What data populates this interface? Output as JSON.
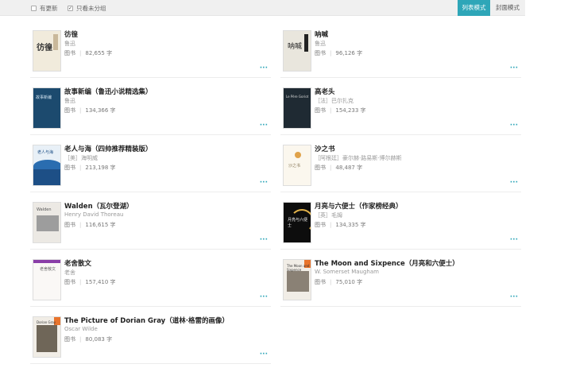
{
  "toolbar": {
    "filter_updated": "有更新",
    "filter_ungrouped": "只看未分组",
    "filter_updated_checked": false,
    "filter_ungrouped_checked": true,
    "mode_list": "列表模式",
    "mode_cover": "封面模式"
  },
  "books": [
    {
      "title": "彷徨",
      "author": "鲁迅",
      "type": "图书",
      "words": "82,655 字",
      "cover_text": "彷徨",
      "cover_icon": "cover-fanghuang"
    },
    {
      "title": "呐喊",
      "author": "鲁迅",
      "type": "图书",
      "words": "96,126 字",
      "cover_text": "呐喊",
      "cover_icon": "cover-nahan"
    },
    {
      "title": "故事新编（鲁迅小说精选集）",
      "author": "鲁迅",
      "type": "图书",
      "words": "134,366 字",
      "cover_text": "故事新编",
      "cover_icon": "cover-gushi"
    },
    {
      "title": "高老头",
      "author": "［法］巴尔扎克",
      "type": "图书",
      "words": "154,233 字",
      "cover_text": "Le Père Goriot",
      "cover_icon": "cover-gaolao"
    },
    {
      "title": "老人与海（四帅推荐精装版）",
      "author": "［美］海明威",
      "type": "图书",
      "words": "213,198 字",
      "cover_text": "老人与海",
      "cover_icon": "cover-laoren"
    },
    {
      "title": "沙之书",
      "author": "［阿根廷］豪尔赫·路易斯·博尔赫斯",
      "type": "图书",
      "words": "48,487 字",
      "cover_text": "沙之书",
      "cover_icon": "cover-shazhi"
    },
    {
      "title": "Walden（瓦尔登湖）",
      "author": "Henry David Thoreau",
      "type": "图书",
      "words": "116,615 字",
      "cover_text": "Walden",
      "cover_icon": "cover-walden"
    },
    {
      "title": "月亮与六便士（作家榜经典）",
      "author": "［英］毛姆",
      "type": "图书",
      "words": "134,335 字",
      "cover_text": "月亮与六便士",
      "cover_icon": "cover-yueliang"
    },
    {
      "title": "老舍散文",
      "author": "老舍",
      "type": "图书",
      "words": "157,410 字",
      "cover_text": "老舍散文",
      "cover_icon": "cover-laoshe"
    },
    {
      "title": "The Moon and Sixpence（月亮和六便士）",
      "author": "W. Somerset Maugham",
      "type": "图书",
      "words": "75,010 字",
      "cover_text": "The Moon and Sixpence",
      "cover_icon": "cover-moon"
    },
    {
      "title": "The Picture of Dorian Gray（道林·格雷的画像）",
      "author": "Oscar Wilde",
      "type": "图书",
      "words": "80,083 字",
      "cover_text": "Dorian Gray",
      "cover_icon": "cover-dorian"
    }
  ],
  "more_label": "···",
  "accent_color": "#2ea6b8"
}
